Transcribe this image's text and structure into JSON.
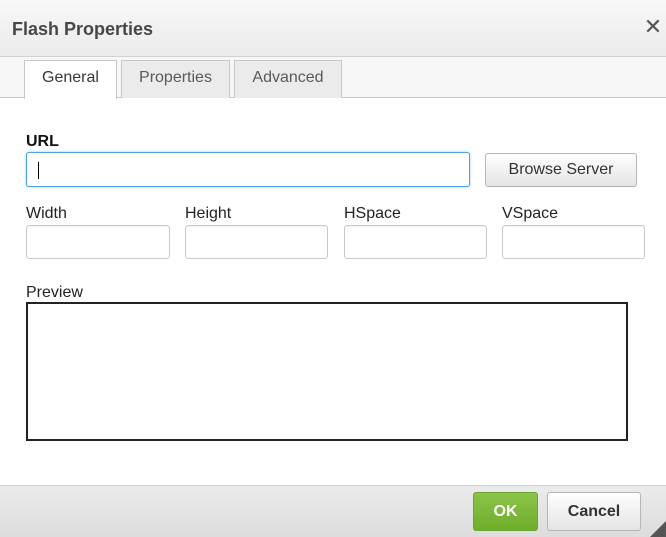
{
  "dialog": {
    "title": "Flash Properties",
    "close_glyph": "✕"
  },
  "tabs": [
    {
      "label": "General",
      "active": true
    },
    {
      "label": "Properties",
      "active": false
    },
    {
      "label": "Advanced",
      "active": false
    }
  ],
  "general": {
    "url_label": "URL",
    "url_value": "",
    "browse_label": "Browse Server",
    "width_label": "Width",
    "width_value": "",
    "height_label": "Height",
    "height_value": "",
    "hspace_label": "HSpace",
    "hspace_value": "",
    "vspace_label": "VSpace",
    "vspace_value": "",
    "preview_label": "Preview"
  },
  "footer": {
    "ok_label": "OK",
    "cancel_label": "Cancel"
  },
  "colors": {
    "ok_button": "#7ab93a",
    "focus_border": "#4aa3df",
    "title_text": "#474747"
  },
  "icons": {
    "close": "close-icon",
    "resize": "resize-grip-icon"
  }
}
